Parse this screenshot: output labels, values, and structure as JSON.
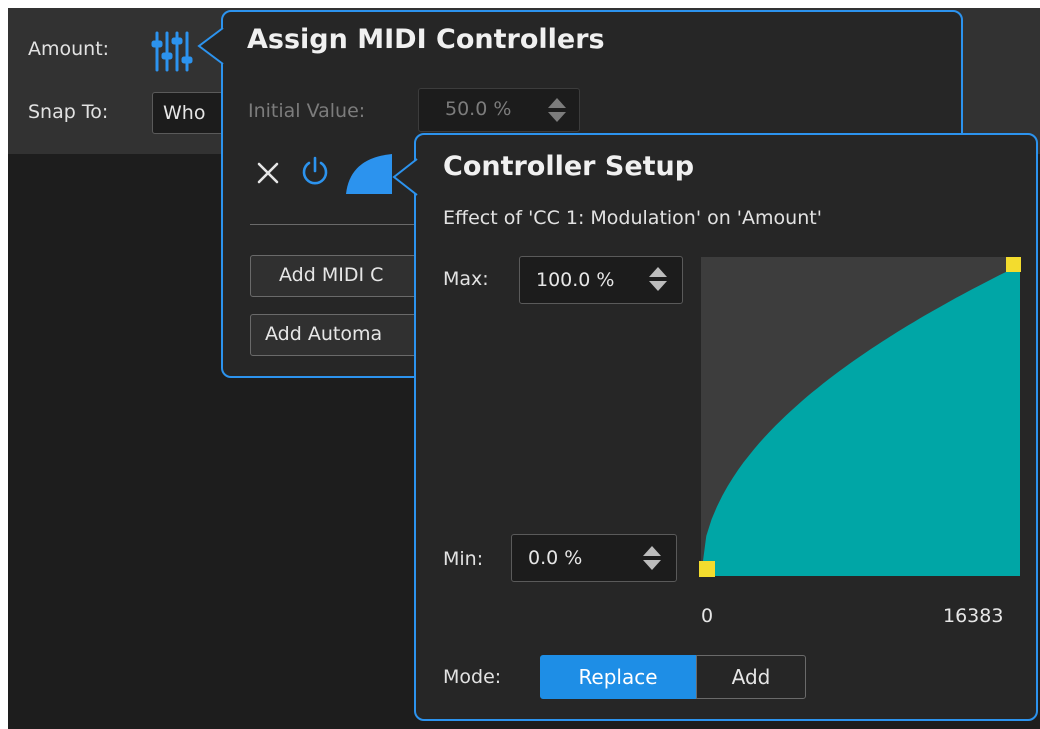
{
  "background": {
    "amount_label": "Amount:",
    "snap_label": "Snap To:",
    "snap_value": "Who",
    "sliders_icon": "sliders-icon"
  },
  "assign_panel": {
    "title": "Assign MIDI Controllers",
    "initial_value_label": "Initial Value:",
    "initial_value": "50.0 %",
    "add_midi_label": "Add MIDI C",
    "add_automation_label": "Add Automa",
    "icons": [
      "close-icon",
      "power-icon",
      "curve-icon"
    ]
  },
  "controller_panel": {
    "title": "Controller Setup",
    "effect_text": "Effect of 'CC 1: Modulation' on 'Amount'",
    "max_label": "Max:",
    "max_value": "100.0 %",
    "min_label": "Min:",
    "min_value": "0.0 %",
    "x_min_label": "0",
    "x_max_label": "16383",
    "mode_label": "Mode:",
    "mode_options": [
      "Replace",
      "Add"
    ],
    "mode_selected": "Replace"
  },
  "colors": {
    "accent": "#2c93ee",
    "curve_fill": "#00a6a6",
    "handle": "#f3dc2e",
    "chart_bg": "#3d3d3d"
  }
}
